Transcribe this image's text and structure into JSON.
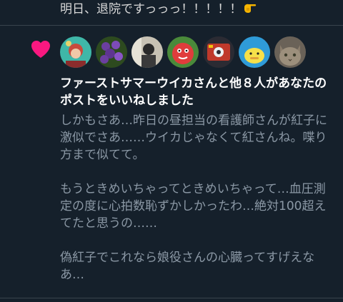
{
  "previous_tweet": {
    "text": "明日、退院ですっっっ！！！！！",
    "emoji": "pointing-hand-emoji"
  },
  "notification": {
    "type": "like",
    "icon": "heart-icon",
    "icon_color": "#f91880",
    "avatars": [
      {
        "name": "avatar-1"
      },
      {
        "name": "avatar-2"
      },
      {
        "name": "avatar-3"
      },
      {
        "name": "avatar-4"
      },
      {
        "name": "avatar-5"
      },
      {
        "name": "avatar-6"
      },
      {
        "name": "avatar-7"
      }
    ],
    "title": "ファーストサマーウイカさんと他８人があなたのポストをいいねしました",
    "body_paragraphs": [
      "しかもさあ…昨日の昼担当の看護師さんが紅子に激似でさあ……ウイカじゃなくて紅さんね。喋り方まで似てて。",
      "もうときめいちゃってときめいちゃって…血圧測定の度に心拍数恥ずかしかったわ…絶対100超えてたと思うの……",
      "偽紅子でこれなら娘役さんの心臓ってすげえなあ…"
    ]
  },
  "colors": {
    "background": "#15202b",
    "primary_text": "#ffffff",
    "secondary_text": "#8b98a5",
    "divider": "#38444d",
    "like": "#f91880"
  }
}
